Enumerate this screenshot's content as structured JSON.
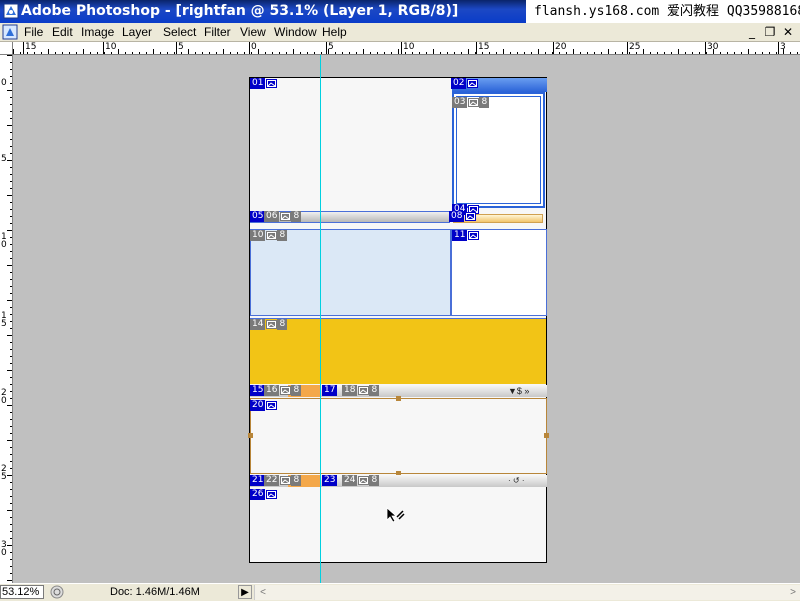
{
  "window": {
    "app_title": "Adobe Photoshop - [rightfan @ 53.1% (Layer 1, RGB/8)]",
    "watermark": "flansh.ys168.com 爱闪教程 QQ359881688",
    "controls": {
      "minimize": "_",
      "restore": "❐",
      "close": "✕"
    }
  },
  "menu": {
    "items": [
      {
        "label": "File"
      },
      {
        "label": "Edit"
      },
      {
        "label": "Image"
      },
      {
        "label": "Layer"
      },
      {
        "label": "Select"
      },
      {
        "label": "Filter"
      },
      {
        "label": "View"
      },
      {
        "label": "Window"
      },
      {
        "label": "Help"
      }
    ]
  },
  "ruler": {
    "top_labels": [
      "15",
      "10",
      "5",
      "0",
      "5",
      "10",
      "15",
      "20",
      "25",
      "30",
      "3"
    ],
    "left_labels": [
      "0",
      "5",
      "1\n0",
      "1\n5",
      "2\n0",
      "2\n5",
      "3\n0"
    ]
  },
  "slices": {
    "s01": "01",
    "s02": "02",
    "s03": "03",
    "s04": "04",
    "s05": "05",
    "s06": "06",
    "s08": "08",
    "s10": "10",
    "s11": "11",
    "s14": "14",
    "s15": "15",
    "s16": "16",
    "s17": "17",
    "s18": "18",
    "s20": "20",
    "s21": "21",
    "s22": "22",
    "s23": "23",
    "s24": "24",
    "s26": "26",
    "link": "8"
  },
  "colors": {
    "slice_blue": "#0000c8",
    "slice_gray": "#7a7a7a",
    "panel_blue": "#dbe8f6",
    "band_yellow": "#f2c416",
    "guide_cyan": "#00d0e0",
    "frame_blue": "#2b63d8"
  },
  "status": {
    "zoom": "53.12%",
    "doc_info": "Doc: 1.46M/1.46M",
    "menu_arrow": "▶"
  },
  "scroll": {
    "left": "<",
    "right": ">"
  }
}
